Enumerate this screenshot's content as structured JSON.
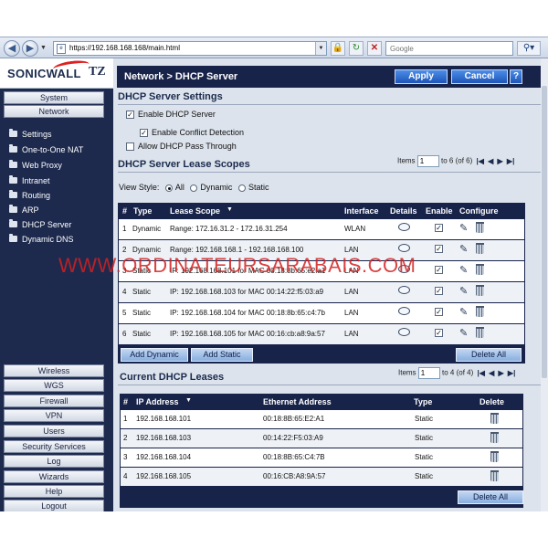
{
  "browser": {
    "address": "https://192.168.168.168/main.html",
    "search_placeholder": "Google"
  },
  "brand": {
    "name": "SONICWALL",
    "model": "TZ"
  },
  "sidebar": {
    "top_tabs": [
      "System",
      "Network"
    ],
    "links": [
      "Settings",
      "One-to-One NAT",
      "Web Proxy",
      "Intranet",
      "Routing",
      "ARP",
      "DHCP Server",
      "Dynamic DNS"
    ],
    "bottom_tabs": [
      "Wireless",
      "WGS",
      "Firewall",
      "VPN",
      "Users",
      "Security Services",
      "Log",
      "Wizards",
      "Help",
      "Logout"
    ]
  },
  "header": {
    "title": "Network > DHCP Server",
    "apply": "Apply",
    "cancel": "Cancel",
    "help": "?"
  },
  "settings": {
    "title": "DHCP Server Settings",
    "enable_dhcp": "Enable DHCP Server",
    "enable_conflict": "Enable Conflict Detection",
    "allow_passthrough": "Allow DHCP Pass Through",
    "checked_mark": "✓"
  },
  "scopes": {
    "title": "DHCP Server Lease Scopes",
    "pager_label": "Items",
    "pager_value": "1",
    "pager_text": "to 6 (of 6)",
    "view_style_label": "View Style:",
    "view_all": "All",
    "view_dynamic": "Dynamic",
    "view_static": "Static",
    "columns": [
      "#",
      "Type",
      "Lease Scope",
      "Interface",
      "Details",
      "Enable",
      "Configure"
    ],
    "rows": [
      {
        "num": "1",
        "type": "Dynamic",
        "scope": "Range: 172.16.31.2 - 172.16.31.254",
        "iface": "WLAN"
      },
      {
        "num": "2",
        "type": "Dynamic",
        "scope": "Range: 192.168.168.1 - 192.168.168.100",
        "iface": "LAN"
      },
      {
        "num": "3",
        "type": "Static",
        "scope": "IP: 192.168.168.101 for MAC 00:18:8b:65:e2:a1",
        "iface": "LAN"
      },
      {
        "num": "4",
        "type": "Static",
        "scope": "IP: 192.168.168.103 for MAC 00:14:22:f5:03:a9",
        "iface": "LAN"
      },
      {
        "num": "5",
        "type": "Static",
        "scope": "IP: 192.168.168.104 for MAC 00:18:8b:65:c4:7b",
        "iface": "LAN"
      },
      {
        "num": "6",
        "type": "Static",
        "scope": "IP: 192.168.168.105 for MAC 00:16:cb:a8:9a:57",
        "iface": "LAN"
      }
    ],
    "add_dynamic": "Add Dynamic",
    "add_static": "Add Static",
    "delete_all": "Delete All"
  },
  "leases": {
    "title": "Current DHCP Leases",
    "pager_label": "Items",
    "pager_value": "1",
    "pager_text": "to 4 (of 4)",
    "columns": [
      "#",
      "IP Address",
      "Ethernet Address",
      "Type",
      "Delete"
    ],
    "rows": [
      {
        "num": "1",
        "ip": "192.168.168.101",
        "mac": "00:18:8B:65:E2:A1",
        "type": "Static"
      },
      {
        "num": "2",
        "ip": "192.168.168.103",
        "mac": "00:14:22:F5:03:A9",
        "type": "Static"
      },
      {
        "num": "3",
        "ip": "192.168.168.104",
        "mac": "00:18:8B:65:C4:7B",
        "type": "Static"
      },
      {
        "num": "4",
        "ip": "192.168.168.105",
        "mac": "00:16:CB:A8:9A:57",
        "type": "Static"
      }
    ],
    "delete_all": "Delete All"
  },
  "watermark": "WWW.ORDINATEURSARABAIS.COM"
}
